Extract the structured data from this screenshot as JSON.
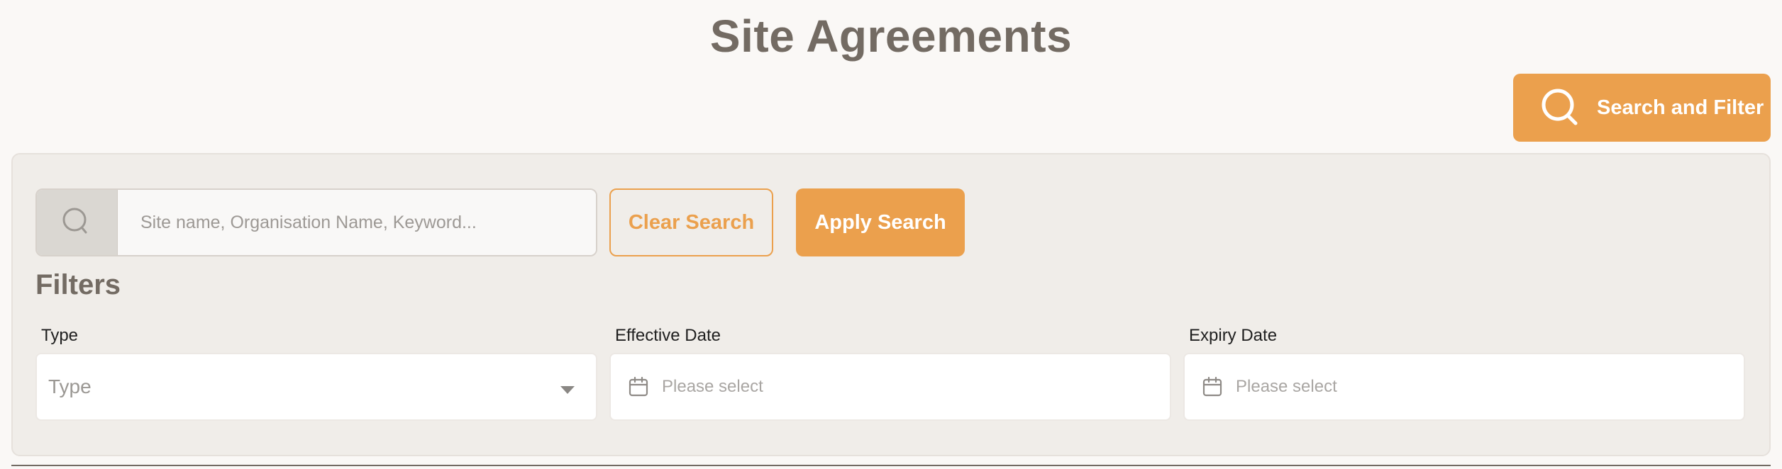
{
  "page": {
    "title": "Site Agreements"
  },
  "header": {
    "search_filter_label": "Search and Filter",
    "search_filter_icon": "search-icon"
  },
  "search": {
    "placeholder": "Site name, Organisation Name, Keyword...",
    "value": "",
    "icon": "search-icon",
    "clear_label": "Clear Search",
    "apply_label": "Apply Search"
  },
  "filters": {
    "heading": "Filters",
    "type": {
      "label": "Type",
      "value": "Type"
    },
    "effective_date": {
      "label": "Effective Date",
      "placeholder": "Please select",
      "icon": "calendar-icon"
    },
    "expiry_date": {
      "label": "Expiry Date",
      "placeholder": "Please select",
      "icon": "calendar-icon"
    }
  },
  "colors": {
    "accent": "#eba04d",
    "title": "#736b63",
    "panel_bg": "#f0ede9",
    "page_bg": "#faf8f6"
  }
}
